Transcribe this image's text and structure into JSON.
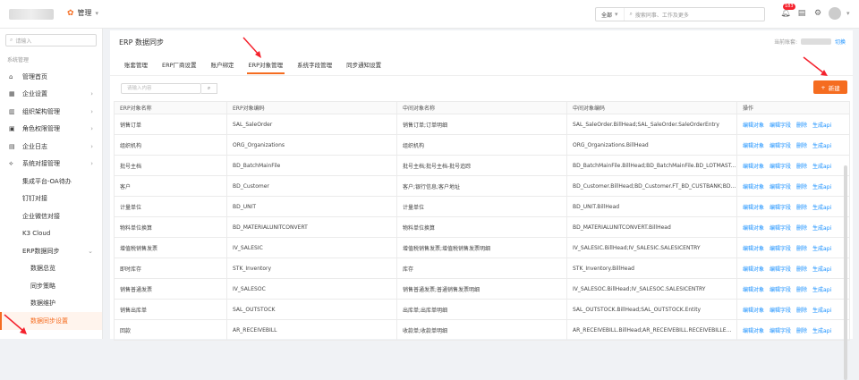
{
  "topbar": {
    "app_name": "管理",
    "search_scope": "全部",
    "search_placeholder": "搜索同事、工作及更多",
    "notif_count": "183"
  },
  "sidebar": {
    "search_placeholder": "请输入",
    "section": "系统管理",
    "items": [
      {
        "label": "管理首页",
        "icon": "home-icon",
        "arrow": false,
        "level": 0
      },
      {
        "label": "企业设置",
        "icon": "building-icon",
        "arrow": true,
        "level": 0
      },
      {
        "label": "组织架构管理",
        "icon": "org-icon",
        "arrow": true,
        "level": 0
      },
      {
        "label": "角色权限管理",
        "icon": "id-card-icon",
        "arrow": true,
        "level": 0
      },
      {
        "label": "企业日志",
        "icon": "log-icon",
        "arrow": true,
        "level": 0
      },
      {
        "label": "系统对接管理",
        "icon": "link-icon",
        "arrow": true,
        "level": 0
      },
      {
        "label": "集成平台-OA待办",
        "level": 1
      },
      {
        "label": "钉钉对接",
        "level": 1
      },
      {
        "label": "企业微信对接",
        "level": 1
      },
      {
        "label": "K3 Cloud",
        "level": 1
      },
      {
        "label": "ERP数据同步",
        "level": 1,
        "arrow": true
      },
      {
        "label": "数据总览",
        "level": 2
      },
      {
        "label": "同步策略",
        "level": 2
      },
      {
        "label": "数据维护",
        "level": 2
      },
      {
        "label": "数据同步设置",
        "level": 2,
        "active": true
      }
    ]
  },
  "header": {
    "title": "ERP 数据同步",
    "company_label": "当前账套:",
    "switch_label": "切换"
  },
  "tabs": [
    "账套管理",
    "ERP厂商设置",
    "账户绑定",
    "ERP对象管理",
    "系统字段管理",
    "同步通知设置"
  ],
  "active_tab": 3,
  "filter": {
    "placeholder": "请输入内容"
  },
  "new_button": "新建",
  "table": {
    "columns": [
      "ERP对象名称",
      "ERP对象编码",
      "中间对象名称",
      "中间对象编码",
      "操作"
    ],
    "ops": [
      "编辑对象",
      "编辑字段",
      "删除",
      "生成api"
    ],
    "rows": [
      [
        "销售订单",
        "SAL_SaleOrder",
        "销售订单;订单明细",
        "SAL_SaleOrder.BillHead;SAL_SaleOrder.SaleOrderEntry"
      ],
      [
        "组织机构",
        "ORG_Organizations",
        "组织机构",
        "ORG_Organizations.BillHead"
      ],
      [
        "批号主档",
        "BD_BatchMainFile",
        "批号主档;批号主档-批号追踪",
        "BD_BatchMainFile.BillHead;BD_BatchMainFile.BD_LOTMAST..."
      ],
      [
        "客户",
        "BD_Customer",
        "客户;银行信息;客户地址",
        "BD_Customer.BillHead;BD_Customer.FT_BD_CUSTBANK;BD..."
      ],
      [
        "计量单位",
        "BD_UNIT",
        "计量单位",
        "BD_UNIT.BillHead"
      ],
      [
        "物料单位换算",
        "BD_MATERIALUNITCONVERT",
        "物料单位换算",
        "BD_MATERIALUNITCONVERT.BillHead"
      ],
      [
        "增值税销售发票",
        "IV_SALESIC",
        "增值税销售发票;增值税销售发票明细",
        "IV_SALESIC.BillHead;IV_SALESIC.SALESICENTRY"
      ],
      [
        "即时库存",
        "STK_Inventory",
        "库存",
        "STK_Inventory.BillHead"
      ],
      [
        "销售普通发票",
        "IV_SALESOC",
        "销售普通发票;普通销售发票明细",
        "IV_SALESOC.BillHead;IV_SALESOC.SALESICENTRY"
      ],
      [
        "销售出库单",
        "SAL_OUTSTOCK",
        "出库单;出库单明细",
        "SAL_OUTSTOCK.BillHead;SAL_OUTSTOCK.Entity"
      ],
      [
        "回款",
        "AR_RECEIVEBILL",
        "收款单;收款单明细",
        "AR_RECEIVEBILL.BillHead;AR_RECEIVEBILL.RECEIVEBILLE..."
      ]
    ]
  },
  "colors": {
    "accent": "#f56c20",
    "link": "#1890ff",
    "arrow": "#f5222d"
  }
}
